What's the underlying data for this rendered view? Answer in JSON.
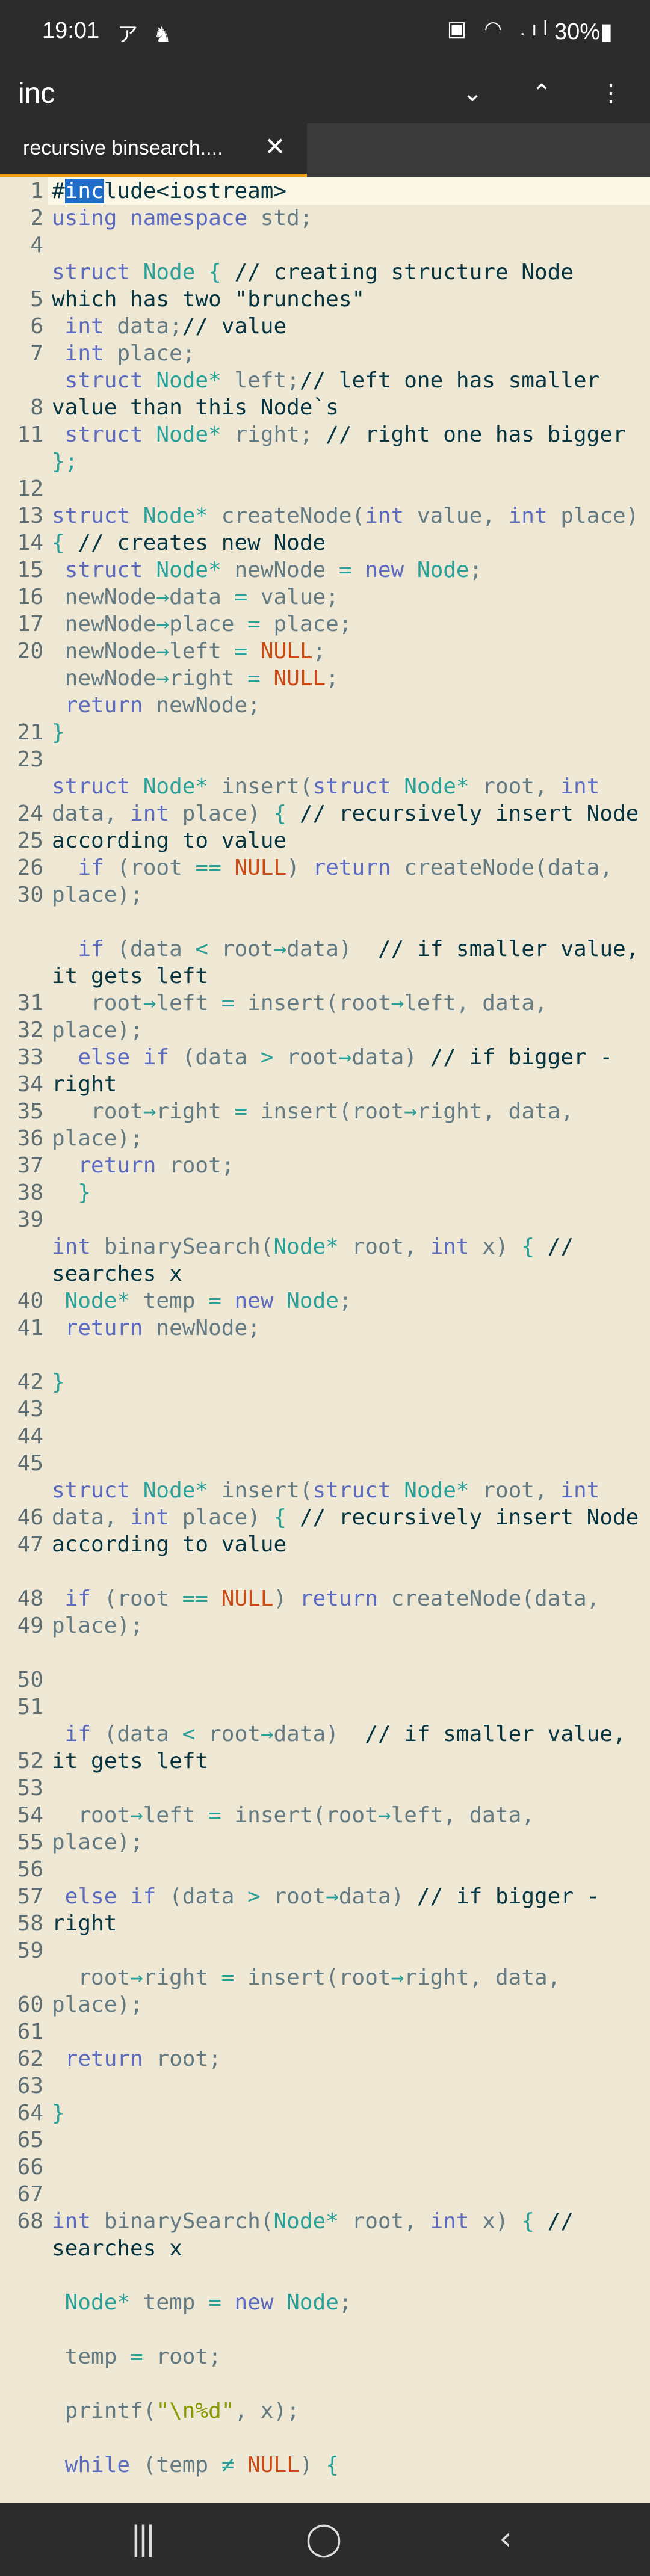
{
  "status_bar": {
    "time": "19:01",
    "left_icons": "ア ♞",
    "right_icons": "▣ ◠ .ıl",
    "battery": "30%▮"
  },
  "search": {
    "value": "inc",
    "down_icon": "⌄",
    "up_icon": "⌃",
    "more_icon": "⋮"
  },
  "tab": {
    "label": "recursive binsearch....",
    "close": "✕"
  },
  "nav": {
    "recent": "|||",
    "home": "◯",
    "back": "‹"
  },
  "line_numbers": [
    {
      "n": "1",
      "row": 0
    },
    {
      "n": "2",
      "row": 1
    },
    {
      "n": "4",
      "row": 2
    },
    {
      "n": "5",
      "row": 4
    },
    {
      "n": "6",
      "row": 5
    },
    {
      "n": "7",
      "row": 6
    },
    {
      "n": "8",
      "row": 8
    },
    {
      "n": "11",
      "row": 9
    },
    {
      "n": "12",
      "row": 11
    },
    {
      "n": "13",
      "row": 12
    },
    {
      "n": "14",
      "row": 13
    },
    {
      "n": "15",
      "row": 14
    },
    {
      "n": "16",
      "row": 15
    },
    {
      "n": "17",
      "row": 16
    },
    {
      "n": "20",
      "row": 17
    },
    {
      "n": "21",
      "row": 20
    },
    {
      "n": "23",
      "row": 21
    },
    {
      "n": "24",
      "row": 23
    },
    {
      "n": "25",
      "row": 24
    },
    {
      "n": "26",
      "row": 25
    },
    {
      "n": "30",
      "row": 26
    },
    {
      "n": "31",
      "row": 30
    },
    {
      "n": "32",
      "row": 31
    },
    {
      "n": "33",
      "row": 32
    },
    {
      "n": "34",
      "row": 33
    },
    {
      "n": "35",
      "row": 34
    },
    {
      "n": "36",
      "row": 35
    },
    {
      "n": "37",
      "row": 36
    },
    {
      "n": "38",
      "row": 37
    },
    {
      "n": "39",
      "row": 38
    },
    {
      "n": "40",
      "row": 41
    },
    {
      "n": "41",
      "row": 42
    },
    {
      "n": "42",
      "row": 44
    },
    {
      "n": "43",
      "row": 45
    },
    {
      "n": "44",
      "row": 46
    },
    {
      "n": "45",
      "row": 47
    },
    {
      "n": "46",
      "row": 49
    },
    {
      "n": "47",
      "row": 50
    },
    {
      "n": "48",
      "row": 52
    },
    {
      "n": "49",
      "row": 53
    },
    {
      "n": "50",
      "row": 55
    },
    {
      "n": "51",
      "row": 56
    },
    {
      "n": "52",
      "row": 58
    },
    {
      "n": "53",
      "row": 59
    },
    {
      "n": "54",
      "row": 60
    },
    {
      "n": "55",
      "row": 61
    },
    {
      "n": "56",
      "row": 62
    },
    {
      "n": "57",
      "row": 63
    },
    {
      "n": "58",
      "row": 64
    },
    {
      "n": "59",
      "row": 65
    },
    {
      "n": "60",
      "row": 67
    },
    {
      "n": "61",
      "row": 68
    },
    {
      "n": "62",
      "row": 69
    },
    {
      "n": "63",
      "row": 70
    },
    {
      "n": "64",
      "row": 71
    },
    {
      "n": "65",
      "row": 72
    },
    {
      "n": "66",
      "row": 73
    },
    {
      "n": "67",
      "row": 74
    },
    {
      "n": "68",
      "row": 75
    }
  ],
  "code_lines": [
    {
      "row": 0,
      "t": [
        [
          "dk",
          "#"
        ],
        [
          "hl",
          "inc"
        ],
        [
          "dk",
          "lude<iostream>"
        ]
      ]
    },
    {
      "row": 1,
      "t": [
        [
          "kw",
          "using namespace "
        ],
        [
          "tx",
          "std;"
        ]
      ]
    },
    {
      "row": 3,
      "t": [
        [
          "kw",
          "struct "
        ],
        [
          "ty",
          "Node "
        ],
        [
          "op",
          "{ "
        ],
        [
          "cm",
          "// creating structure Node"
        ]
      ]
    },
    {
      "row": 4,
      "t": [
        [
          "cm",
          "which has two \"brunches\""
        ]
      ]
    },
    {
      "row": 5,
      "t": [
        [
          "kw",
          " int "
        ],
        [
          "tx",
          "data;"
        ],
        [
          "cm",
          "// value"
        ]
      ]
    },
    {
      "row": 6,
      "t": [
        [
          "kw",
          " int "
        ],
        [
          "tx",
          "place;"
        ]
      ]
    },
    {
      "row": 7,
      "t": [
        [
          "kw",
          " struct "
        ],
        [
          "ty",
          "Node"
        ],
        [
          "op",
          "* "
        ],
        [
          "tx",
          "left;"
        ],
        [
          "cm",
          "// left one has smaller"
        ]
      ]
    },
    {
      "row": 8,
      "t": [
        [
          "cm",
          "value than this Node`s"
        ]
      ]
    },
    {
      "row": 9,
      "t": [
        [
          "kw",
          " struct "
        ],
        [
          "ty",
          "Node"
        ],
        [
          "op",
          "* "
        ],
        [
          "tx",
          "right; "
        ],
        [
          "cm",
          "// right one has bigger"
        ]
      ]
    },
    {
      "row": 10,
      "t": [
        [
          "op",
          "};"
        ]
      ]
    },
    {
      "row": 12,
      "t": [
        [
          "kw",
          "struct "
        ],
        [
          "ty",
          "Node"
        ],
        [
          "op",
          "* "
        ],
        [
          "tx",
          "createNode("
        ],
        [
          "kw",
          "int "
        ],
        [
          "tx",
          "value, "
        ],
        [
          "kw",
          "int "
        ],
        [
          "tx",
          "place)"
        ]
      ]
    },
    {
      "row": 13,
      "t": [
        [
          "op",
          "{ "
        ],
        [
          "cm",
          "// creates new Node"
        ]
      ]
    },
    {
      "row": 14,
      "t": [
        [
          "kw",
          " struct "
        ],
        [
          "ty",
          "Node"
        ],
        [
          "op",
          "* "
        ],
        [
          "tx",
          "newNode "
        ],
        [
          "op",
          "= "
        ],
        [
          "kw",
          "new "
        ],
        [
          "ty",
          "Node"
        ],
        [
          "tx",
          ";"
        ]
      ]
    },
    {
      "row": 15,
      "t": [
        [
          "tx",
          " newNode"
        ],
        [
          "op",
          "→"
        ],
        [
          "tx",
          "data "
        ],
        [
          "op",
          "= "
        ],
        [
          "tx",
          "value;"
        ]
      ]
    },
    {
      "row": 16,
      "t": [
        [
          "tx",
          " newNode"
        ],
        [
          "op",
          "→"
        ],
        [
          "tx",
          "place "
        ],
        [
          "op",
          "= "
        ],
        [
          "tx",
          "place;"
        ]
      ]
    },
    {
      "row": 17,
      "t": [
        [
          "tx",
          " newNode"
        ],
        [
          "op",
          "→"
        ],
        [
          "tx",
          "left "
        ],
        [
          "op",
          "= "
        ],
        [
          "nu",
          "NULL"
        ],
        [
          "tx",
          ";"
        ]
      ]
    },
    {
      "row": 18,
      "t": [
        [
          "tx",
          " newNode"
        ],
        [
          "op",
          "→"
        ],
        [
          "tx",
          "right "
        ],
        [
          "op",
          "= "
        ],
        [
          "nu",
          "NULL"
        ],
        [
          "tx",
          ";"
        ]
      ]
    },
    {
      "row": 19,
      "t": [
        [
          "kw",
          " return "
        ],
        [
          "tx",
          "newNode;"
        ]
      ]
    },
    {
      "row": 20,
      "t": [
        [
          "op",
          "}"
        ]
      ]
    },
    {
      "row": 22,
      "t": [
        [
          "kw",
          "struct "
        ],
        [
          "ty",
          "Node"
        ],
        [
          "op",
          "* "
        ],
        [
          "tx",
          "insert("
        ],
        [
          "kw",
          "struct "
        ],
        [
          "ty",
          "Node"
        ],
        [
          "op",
          "* "
        ],
        [
          "tx",
          "root, "
        ],
        [
          "kw",
          "int"
        ]
      ]
    },
    {
      "row": 23,
      "t": [
        [
          "tx",
          "data, "
        ],
        [
          "kw",
          "int "
        ],
        [
          "tx",
          "place) "
        ],
        [
          "op",
          "{ "
        ],
        [
          "cm",
          "// recursively insert Node"
        ]
      ]
    },
    {
      "row": 24,
      "t": [
        [
          "cm",
          "according to value"
        ]
      ]
    },
    {
      "row": 25,
      "t": [
        [
          "kw",
          "  if "
        ],
        [
          "tx",
          "(root "
        ],
        [
          "op",
          "== "
        ],
        [
          "nu",
          "NULL"
        ],
        [
          "tx",
          ") "
        ],
        [
          "kw",
          "return "
        ],
        [
          "tx",
          "createNode(data,"
        ]
      ]
    },
    {
      "row": 26,
      "t": [
        [
          "tx",
          "place);"
        ]
      ]
    },
    {
      "row": 28,
      "t": [
        [
          "kw",
          "  if "
        ],
        [
          "tx",
          "(data "
        ],
        [
          "op",
          "< "
        ],
        [
          "tx",
          "root"
        ],
        [
          "op",
          "→"
        ],
        [
          "tx",
          "data)  "
        ],
        [
          "cm",
          "// if smaller value,"
        ]
      ]
    },
    {
      "row": 29,
      "t": [
        [
          "cm",
          "it gets left"
        ]
      ]
    },
    {
      "row": 30,
      "t": [
        [
          "tx",
          "   root"
        ],
        [
          "op",
          "→"
        ],
        [
          "tx",
          "left "
        ],
        [
          "op",
          "= "
        ],
        [
          "tx",
          "insert(root"
        ],
        [
          "op",
          "→"
        ],
        [
          "tx",
          "left, data,"
        ]
      ]
    },
    {
      "row": 31,
      "t": [
        [
          "tx",
          "place);"
        ]
      ]
    },
    {
      "row": 32,
      "t": [
        [
          "kw",
          "  else if "
        ],
        [
          "tx",
          "(data "
        ],
        [
          "op",
          "> "
        ],
        [
          "tx",
          "root"
        ],
        [
          "op",
          "→"
        ],
        [
          "tx",
          "data) "
        ],
        [
          "cm",
          "// if bigger -"
        ]
      ]
    },
    {
      "row": 33,
      "t": [
        [
          "cm",
          "right"
        ]
      ]
    },
    {
      "row": 34,
      "t": [
        [
          "tx",
          "   root"
        ],
        [
          "op",
          "→"
        ],
        [
          "tx",
          "right "
        ],
        [
          "op",
          "= "
        ],
        [
          "tx",
          "insert(root"
        ],
        [
          "op",
          "→"
        ],
        [
          "tx",
          "right, data,"
        ]
      ]
    },
    {
      "row": 35,
      "t": [
        [
          "tx",
          "place);"
        ]
      ]
    },
    {
      "row": 36,
      "t": [
        [
          "kw",
          "  return "
        ],
        [
          "tx",
          "root;"
        ]
      ]
    },
    {
      "row": 37,
      "t": [
        [
          "op",
          "  }"
        ]
      ]
    },
    {
      "row": 39,
      "t": [
        [
          "kw",
          "int "
        ],
        [
          "tx",
          "binarySearch("
        ],
        [
          "ty",
          "Node"
        ],
        [
          "op",
          "* "
        ],
        [
          "tx",
          "root, "
        ],
        [
          "kw",
          "int "
        ],
        [
          "tx",
          "x) "
        ],
        [
          "op",
          "{ "
        ],
        [
          "cm",
          "//"
        ]
      ]
    },
    {
      "row": 40,
      "t": [
        [
          "cm",
          "searches x"
        ]
      ]
    },
    {
      "row": 41,
      "t": [
        [
          "ty",
          " Node"
        ],
        [
          "op",
          "* "
        ],
        [
          "tx",
          "temp "
        ],
        [
          "op",
          "= "
        ],
        [
          "kw",
          "new "
        ],
        [
          "ty",
          "Node"
        ],
        [
          "tx",
          ";"
        ]
      ]
    },
    {
      "row": 42,
      "t": [
        [
          "kw",
          " return "
        ],
        [
          "tx",
          "newNode;"
        ]
      ]
    },
    {
      "row": 44,
      "t": [
        [
          "op",
          "}"
        ]
      ]
    },
    {
      "row": 48,
      "t": [
        [
          "kw",
          "struct "
        ],
        [
          "ty",
          "Node"
        ],
        [
          "op",
          "* "
        ],
        [
          "tx",
          "insert("
        ],
        [
          "kw",
          "struct "
        ],
        [
          "ty",
          "Node"
        ],
        [
          "op",
          "* "
        ],
        [
          "tx",
          "root, "
        ],
        [
          "kw",
          "int"
        ]
      ]
    },
    {
      "row": 49,
      "t": [
        [
          "tx",
          "data, "
        ],
        [
          "kw",
          "int "
        ],
        [
          "tx",
          "place) "
        ],
        [
          "op",
          "{ "
        ],
        [
          "cm",
          "// recursively insert Node"
        ]
      ]
    },
    {
      "row": 50,
      "t": [
        [
          "cm",
          "according to value"
        ]
      ]
    },
    {
      "row": 52,
      "t": [
        [
          "kw",
          " if "
        ],
        [
          "tx",
          "(root "
        ],
        [
          "op",
          "== "
        ],
        [
          "nu",
          "NULL"
        ],
        [
          "tx",
          ") "
        ],
        [
          "kw",
          "return "
        ],
        [
          "tx",
          "createNode(data,"
        ]
      ]
    },
    {
      "row": 53,
      "t": [
        [
          "tx",
          "place);"
        ]
      ]
    },
    {
      "row": 57,
      "t": [
        [
          "kw",
          " if "
        ],
        [
          "tx",
          "(data "
        ],
        [
          "op",
          "< "
        ],
        [
          "tx",
          "root"
        ],
        [
          "op",
          "→"
        ],
        [
          "tx",
          "data)  "
        ],
        [
          "cm",
          "// if smaller value,"
        ]
      ]
    },
    {
      "row": 58,
      "t": [
        [
          "cm",
          "it gets left"
        ]
      ]
    },
    {
      "row": 60,
      "t": [
        [
          "tx",
          "  root"
        ],
        [
          "op",
          "→"
        ],
        [
          "tx",
          "left "
        ],
        [
          "op",
          "= "
        ],
        [
          "tx",
          "insert(root"
        ],
        [
          "op",
          "→"
        ],
        [
          "tx",
          "left, data,"
        ]
      ]
    },
    {
      "row": 61,
      "t": [
        [
          "tx",
          "place);"
        ]
      ]
    },
    {
      "row": 63,
      "t": [
        [
          "kw",
          " else if "
        ],
        [
          "tx",
          "(data "
        ],
        [
          "op",
          "> "
        ],
        [
          "tx",
          "root"
        ],
        [
          "op",
          "→"
        ],
        [
          "tx",
          "data) "
        ],
        [
          "cm",
          "// if bigger -"
        ]
      ]
    },
    {
      "row": 64,
      "t": [
        [
          "cm",
          "right"
        ]
      ]
    },
    {
      "row": 66,
      "t": [
        [
          "tx",
          "  root"
        ],
        [
          "op",
          "→"
        ],
        [
          "tx",
          "right "
        ],
        [
          "op",
          "= "
        ],
        [
          "tx",
          "insert(root"
        ],
        [
          "op",
          "→"
        ],
        [
          "tx",
          "right, data,"
        ]
      ]
    },
    {
      "row": 67,
      "t": [
        [
          "tx",
          "place);"
        ]
      ]
    },
    {
      "row": 69,
      "t": [
        [
          "kw",
          " return "
        ],
        [
          "tx",
          "root;"
        ]
      ]
    },
    {
      "row": 71,
      "t": [
        [
          "op",
          "}"
        ]
      ]
    },
    {
      "row": 75,
      "t": [
        [
          "kw",
          "int "
        ],
        [
          "tx",
          "binarySearch("
        ],
        [
          "ty",
          "Node"
        ],
        [
          "op",
          "* "
        ],
        [
          "tx",
          "root, "
        ],
        [
          "kw",
          "int "
        ],
        [
          "tx",
          "x) "
        ],
        [
          "op",
          "{ "
        ],
        [
          "cm",
          "//"
        ]
      ]
    },
    {
      "row": 76,
      "t": [
        [
          "cm",
          "searches x"
        ]
      ]
    },
    {
      "row": 78,
      "t": [
        [
          "ty",
          " Node"
        ],
        [
          "op",
          "* "
        ],
        [
          "tx",
          "temp "
        ],
        [
          "op",
          "= "
        ],
        [
          "kw",
          "new "
        ],
        [
          "ty",
          "Node"
        ],
        [
          "tx",
          ";"
        ]
      ]
    },
    {
      "row": 80,
      "t": [
        [
          "tx",
          " temp "
        ],
        [
          "op",
          "= "
        ],
        [
          "tx",
          "root;"
        ]
      ]
    },
    {
      "row": 82,
      "t": [
        [
          "tx",
          " printf("
        ],
        [
          "st",
          "\"\\n%d\""
        ],
        [
          "tx",
          ", x);"
        ]
      ]
    },
    {
      "row": 84,
      "t": [
        [
          "kw",
          " while "
        ],
        [
          "tx",
          "(temp "
        ],
        [
          "op",
          "≠ "
        ],
        [
          "nu",
          "NULL"
        ],
        [
          "tx",
          ") "
        ],
        [
          "op",
          "{"
        ]
      ]
    }
  ]
}
